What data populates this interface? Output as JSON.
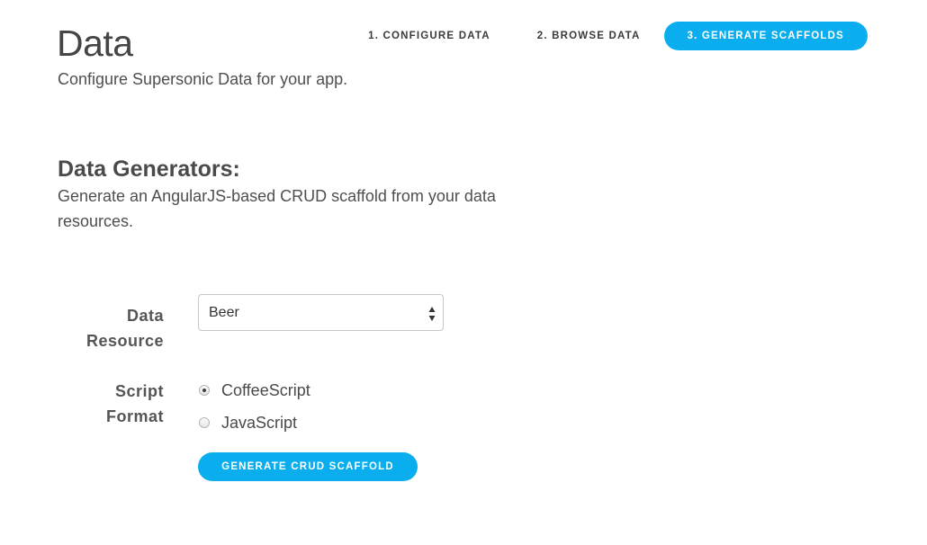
{
  "header": {
    "title": "Data",
    "subtitle": "Configure Supersonic Data for your app."
  },
  "steps": [
    {
      "label": "1. CONFIGURE DATA",
      "active": false
    },
    {
      "label": "2. BROWSE DATA",
      "active": false
    },
    {
      "label": "3. GENERATE SCAFFOLDS",
      "active": true
    }
  ],
  "section": {
    "title": "Data Generators:",
    "description": "Generate an AngularJS-based CRUD scaffold from your data resources."
  },
  "form": {
    "data_resource": {
      "label_line1": "Data",
      "label_line2": "Resource",
      "selected": "Beer",
      "arrow_icon": "select-arrows-icon"
    },
    "script_format": {
      "label_line1": "Script",
      "label_line2": "Format",
      "options": [
        {
          "label": "CoffeeScript",
          "checked": true
        },
        {
          "label": "JavaScript",
          "checked": false
        }
      ]
    },
    "submit_label": "GENERATE CRUD SCAFFOLD"
  },
  "colors": {
    "accent": "#0aaeef",
    "text": "#4a4a4a"
  }
}
